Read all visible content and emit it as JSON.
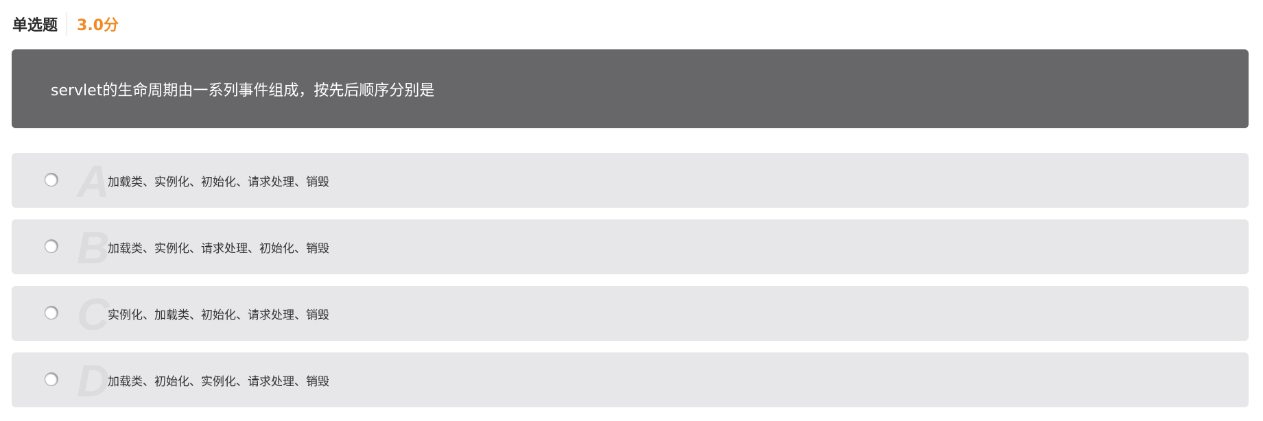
{
  "header": {
    "type": "单选题",
    "score": "3.0分"
  },
  "question": "servlet的生命周期由一系列事件组成，按先后顺序分别是",
  "options": [
    {
      "letter": "A",
      "text": "加载类、实例化、初始化、请求处理、销毁"
    },
    {
      "letter": "B",
      "text": "加载类、实例化、请求处理、初始化、销毁"
    },
    {
      "letter": "C",
      "text": "实例化、加载类、初始化、请求处理、销毁"
    },
    {
      "letter": "D",
      "text": "加载类、初始化、实例化、请求处理、销毁"
    }
  ],
  "colors": {
    "accent": "#f08a24",
    "question_bg": "#676668",
    "option_bg": "#e7e6e8"
  }
}
